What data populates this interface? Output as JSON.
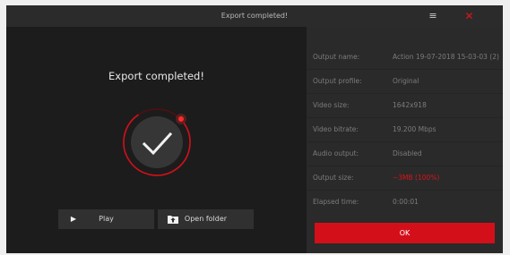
{
  "window": {
    "title": "Export completed!",
    "minimize_icon": "minimize-icon",
    "close_icon": "close-icon",
    "accent_color": "#d3101a"
  },
  "main": {
    "heading": "Export completed!",
    "status_icon": "check-circle-icon",
    "play_label": "Play",
    "play_icon": "play-icon",
    "open_folder_label": "Open folder",
    "open_folder_icon": "folder-upload-icon"
  },
  "details": [
    {
      "label": "Output name:",
      "value": "Action 19-07-2018 15-03-03 (2)"
    },
    {
      "label": "Output profile:",
      "value": "Original"
    },
    {
      "label": "Video size:",
      "value": "1642x918"
    },
    {
      "label": "Video bitrate:",
      "value": "19.200 Mbps"
    },
    {
      "label": "Audio output:",
      "value": "Disabled"
    },
    {
      "label": "Output size:",
      "value": "~3MB (100%)"
    },
    {
      "label": "Elapsed time:",
      "value": "0:00:01"
    }
  ],
  "ok_label": "OK"
}
